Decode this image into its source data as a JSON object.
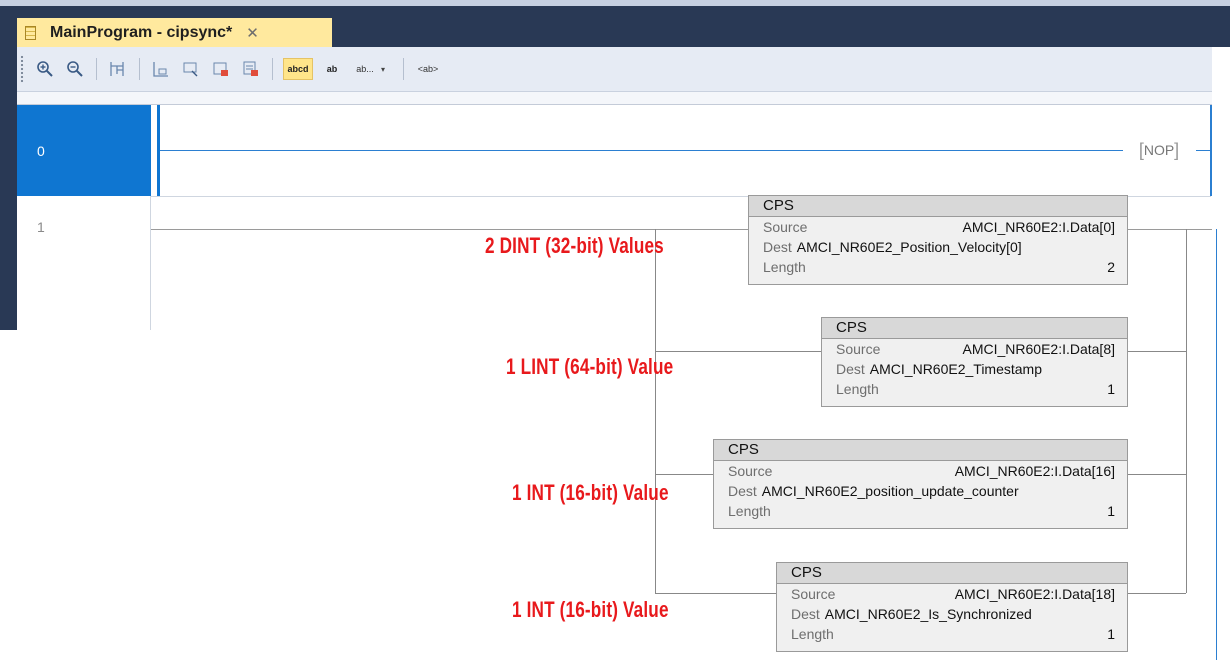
{
  "window": {
    "tab_title": "MainProgram - cipsync*",
    "close_glyph": "✕"
  },
  "toolbar": {
    "buttons": [
      "zoom-in-icon",
      "zoom-out-icon",
      "rung-tree-icon",
      "add-rung-icon",
      "add-branch-icon",
      "add-contact-icon",
      "add-instruction-icon",
      "show-text-icon",
      "tag-swap-icon",
      "display-format-icon",
      "description-toggle-icon"
    ],
    "text_button_1": "abcd",
    "text_button_2": "ab",
    "text_button_3": "ab...",
    "text_button_4": "<ab>"
  },
  "rungs": [
    {
      "number": "0",
      "instruction": "NOP"
    },
    {
      "number": "1"
    }
  ],
  "cps_blocks": [
    {
      "name": "CPS",
      "source_label": "Source",
      "source": "AMCI_NR60E2:I.Data[0]",
      "dest_label": "Dest",
      "dest": "AMCI_NR60E2_Position_Velocity[0]",
      "length_label": "Length",
      "length": "2"
    },
    {
      "name": "CPS",
      "source_label": "Source",
      "source": "AMCI_NR60E2:I.Data[8]",
      "dest_label": "Dest",
      "dest": "AMCI_NR60E2_Timestamp",
      "length_label": "Length",
      "length": "1"
    },
    {
      "name": "CPS",
      "source_label": "Source",
      "source": "AMCI_NR60E2:I.Data[16]",
      "dest_label": "Dest",
      "dest": "AMCI_NR60E2_position_update_counter",
      "length_label": "Length",
      "length": "1"
    },
    {
      "name": "CPS",
      "source_label": "Source",
      "source": "AMCI_NR60E2:I.Data[18]",
      "dest_label": "Dest",
      "dest": "AMCI_NR60E2_Is_Synchronized",
      "length_label": "Length",
      "length": "1"
    }
  ],
  "annotations": [
    "2 DINT (32-bit) Values",
    "1 LINT (64-bit) Value",
    "1 INT (16-bit) Value",
    "1 INT (16-bit) Value"
  ],
  "colors": {
    "frame": "#293955",
    "tab": "#ffe99e",
    "selection": "#0f76d1",
    "annotation": "#e8191c"
  }
}
